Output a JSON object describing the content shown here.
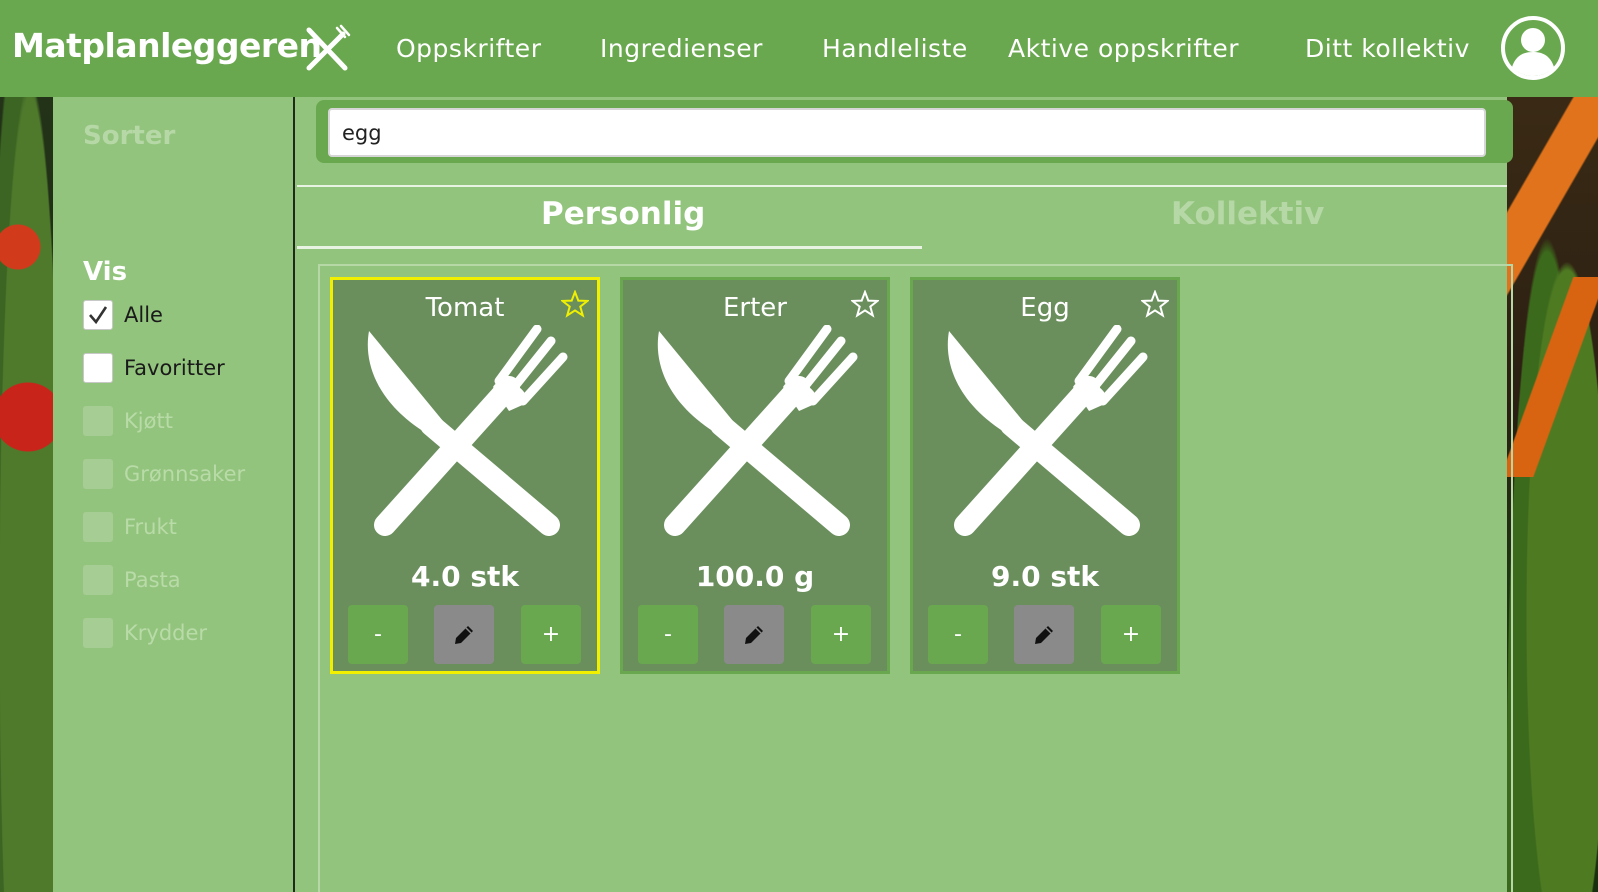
{
  "app": {
    "title": "Matplanleggeren",
    "icon": "cutlery-icon"
  },
  "nav": {
    "items": [
      "Oppskrifter",
      "Ingredienser",
      "Handleliste",
      "Aktive oppskrifter",
      "Ditt kollektiv"
    ],
    "profile_icon": "user-avatar-icon"
  },
  "sidebar": {
    "sort_label": "Sorter",
    "show_label": "Vis",
    "filters": [
      {
        "label": "Alle",
        "checked": true,
        "enabled": true
      },
      {
        "label": "Favoritter",
        "checked": false,
        "enabled": true
      },
      {
        "label": "Kjøtt",
        "checked": false,
        "enabled": false
      },
      {
        "label": "Grønnsaker",
        "checked": false,
        "enabled": false
      },
      {
        "label": "Frukt",
        "checked": false,
        "enabled": false
      },
      {
        "label": "Pasta",
        "checked": false,
        "enabled": false
      },
      {
        "label": "Krydder",
        "checked": false,
        "enabled": false
      }
    ]
  },
  "search": {
    "value": "egg"
  },
  "tabs": {
    "personal": "Personlig",
    "collective": "Kollektiv",
    "active": "Personlig"
  },
  "cards": [
    {
      "name": "Tomat",
      "amount": "4.0 stk",
      "favorite": true,
      "selected": true
    },
    {
      "name": "Erter",
      "amount": "100.0 g",
      "favorite": false,
      "selected": false
    },
    {
      "name": "Egg",
      "amount": "9.0 stk",
      "favorite": false,
      "selected": false
    }
  ],
  "card_buttons": {
    "minus": "-",
    "plus": "+",
    "edit_icon": "pencil-icon"
  },
  "colors": {
    "header": "#6aa84f",
    "background": "#93c47d",
    "card": "#6a8f5d",
    "selected_border": "#f0f000",
    "favorite_star": "#f0f000"
  }
}
